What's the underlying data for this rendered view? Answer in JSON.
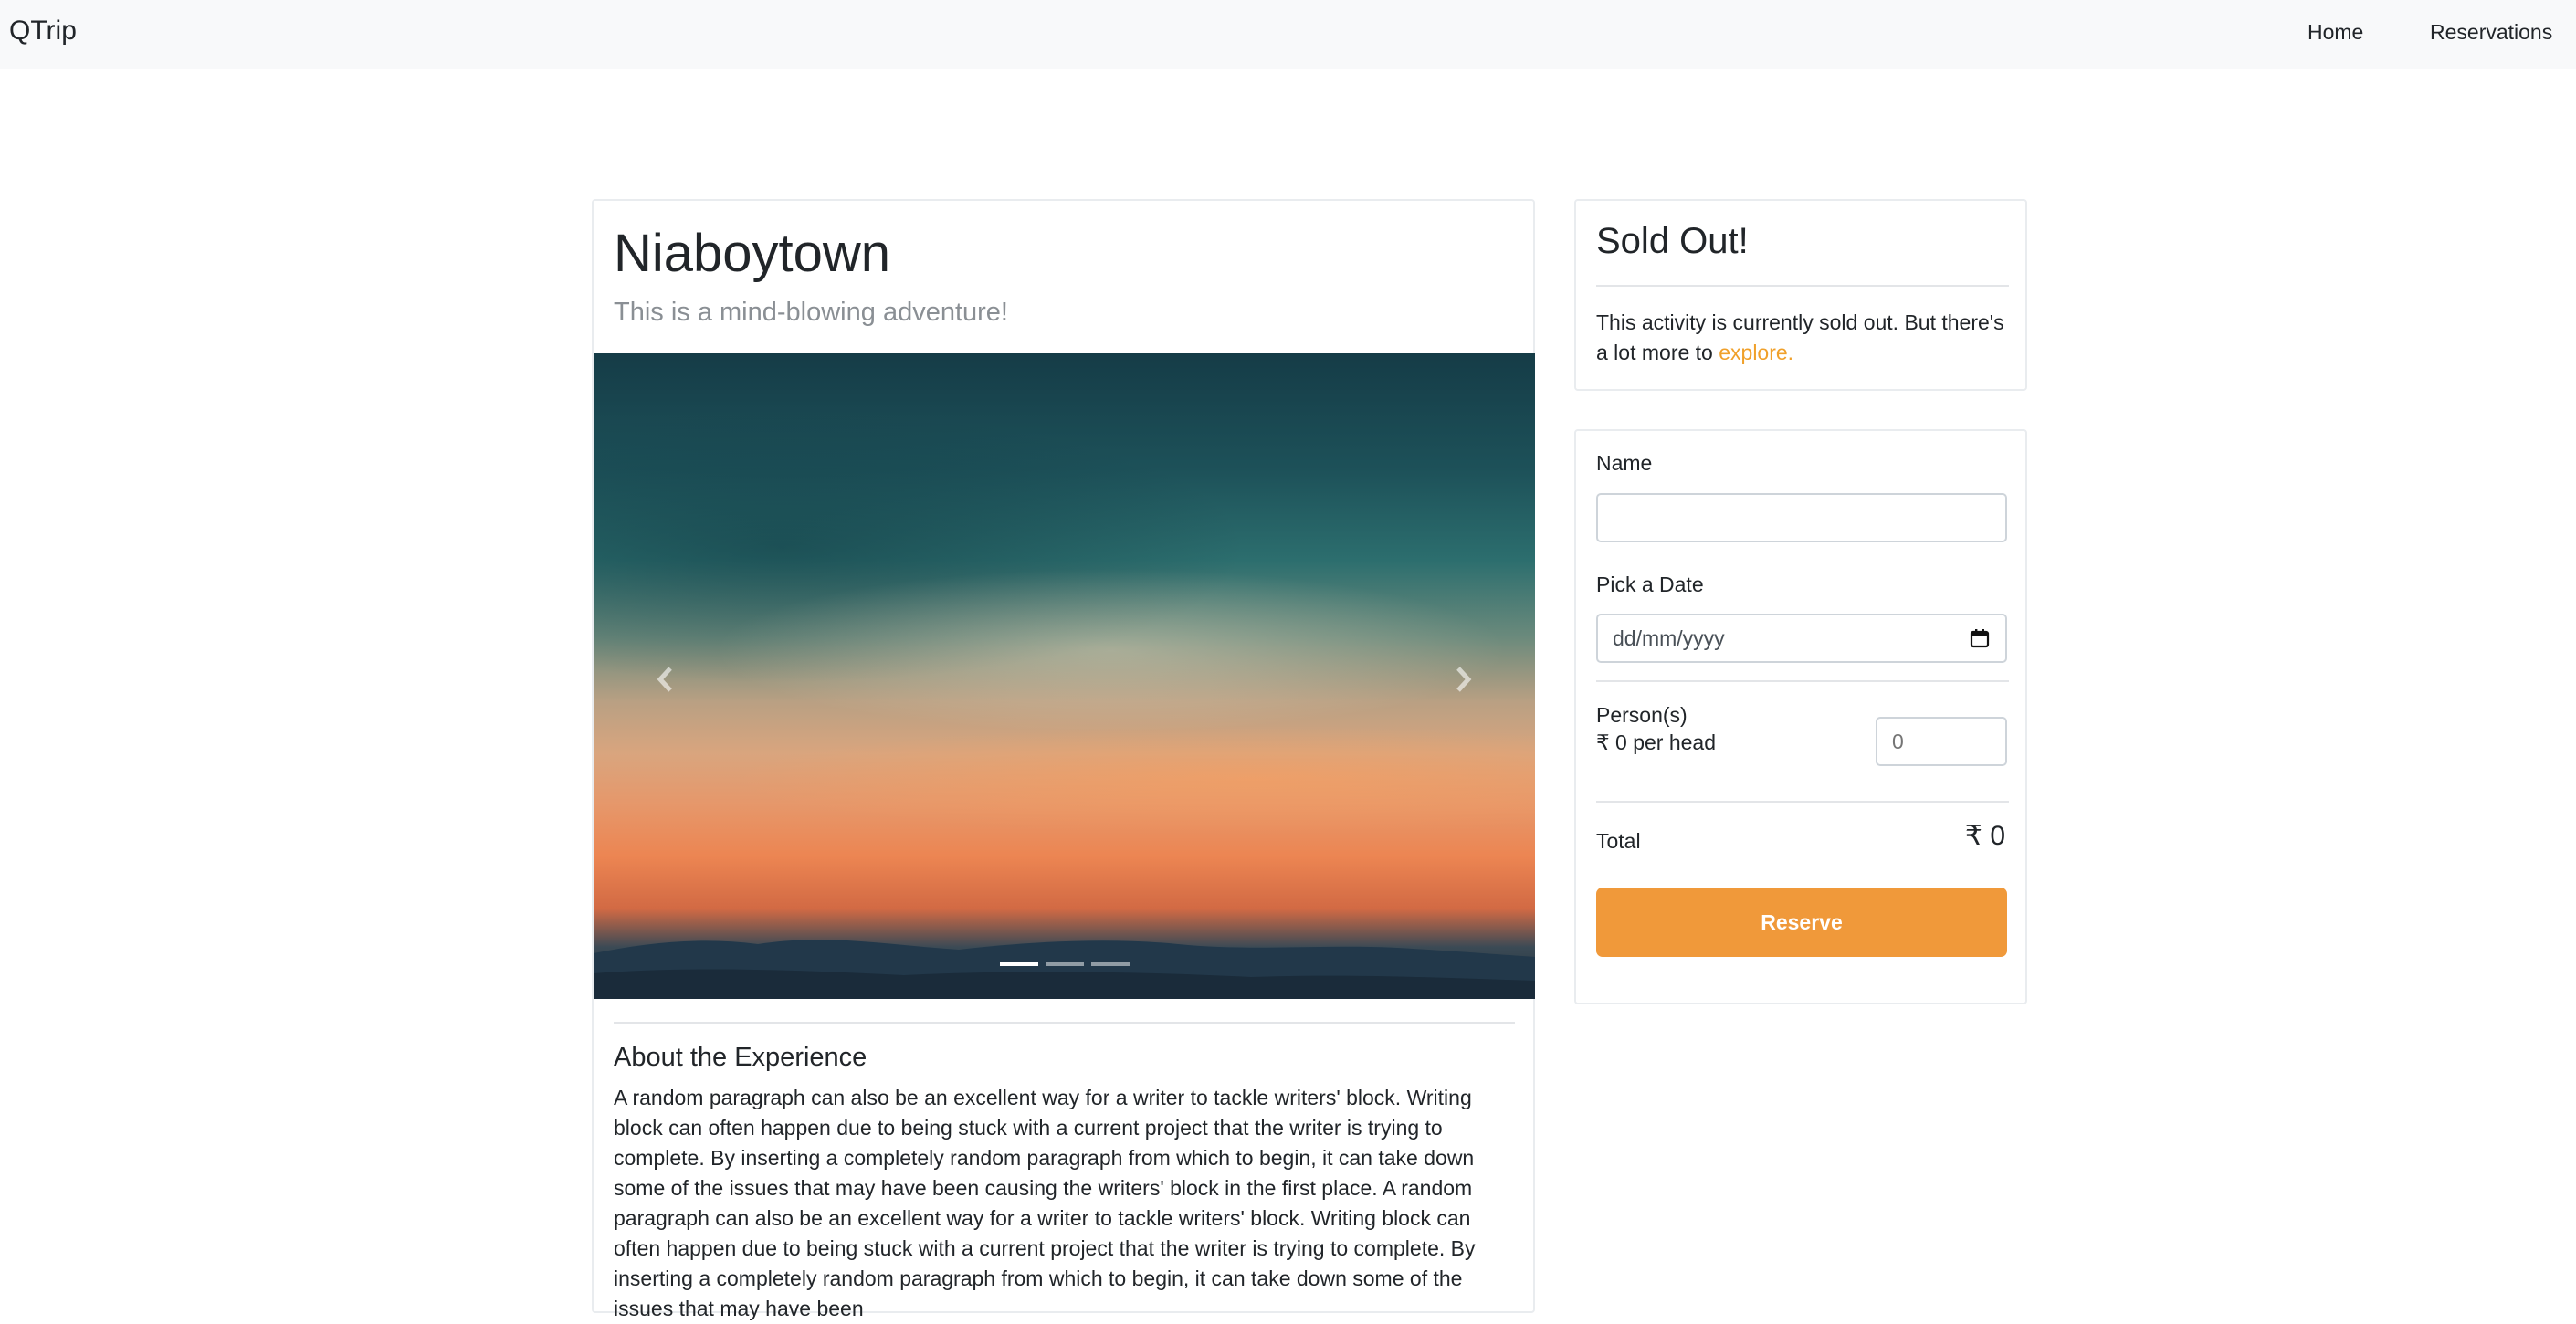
{
  "navbar": {
    "brand": "QTrip",
    "links": [
      "Home",
      "Reservations"
    ]
  },
  "adventure": {
    "title": "Niaboytown",
    "subtitle": "This is a mind-blowing adventure!",
    "carousel": {
      "slide_count": 3,
      "active_slide": 1
    },
    "about_title": "About the Experience",
    "about_text": "A random paragraph can also be an excellent way for a writer to tackle writers' block. Writing block can often happen due to being stuck with a current project that the writer is trying to complete. By inserting a completely random paragraph from which to begin, it can take down some of the issues that may have been causing the writers' block in the first place. A random paragraph can also be an excellent way for a writer to tackle writers' block. Writing block can often happen due to being stuck with a current project that the writer is trying to complete. By inserting a completely random paragraph from which to begin, it can take down some of the issues that may have been"
  },
  "sold_out": {
    "title": "Sold Out!",
    "text": "This activity is currently sold out. But there's a lot more to ",
    "link": "explore."
  },
  "form": {
    "name_label": "Name",
    "name_value": "",
    "date_label": "Pick a Date",
    "date_placeholder": "dd/mm/yyyy",
    "persons_label": "Person(s)",
    "per_head": "₹ 0 per head",
    "persons_value": "0",
    "total_label": "Total",
    "total_value": "₹ 0",
    "reserve_label": "Reserve"
  },
  "colors": {
    "accent": "#f0993a",
    "link": "#f0a02a",
    "navbar_bg": "#f8f9fa"
  },
  "icons": [
    "chevron-left-icon",
    "chevron-right-icon",
    "calendar-icon"
  ]
}
